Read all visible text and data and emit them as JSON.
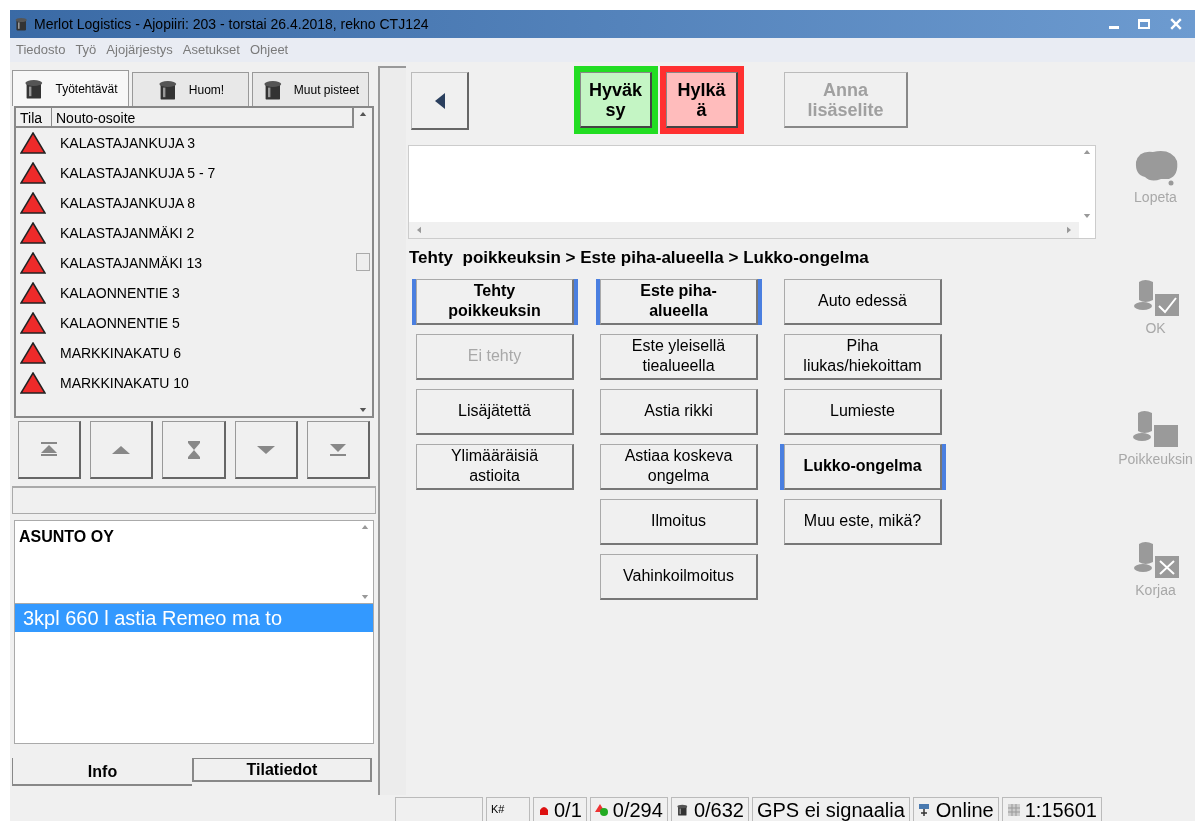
{
  "window": {
    "title": "Merlot Logistics - Ajopiiri:  203 - torstai 26.4.2018, rekno CTJ124"
  },
  "menu": [
    "Tiedosto",
    "Työ",
    "Ajojärjestys",
    "Asetukset",
    "Ohjeet"
  ],
  "top_tabs": [
    {
      "label": "Työtehtävät",
      "selected": true
    },
    {
      "label": "Huom!",
      "selected": false
    },
    {
      "label": "Muut pisteet",
      "selected": false
    }
  ],
  "table": {
    "columns": [
      "Tila",
      "Nouto-osoite"
    ],
    "rows": [
      {
        "address": "KALASTAJANKUJA 3",
        "kind": "warning"
      },
      {
        "address": "KALASTAJANKUJA 5 - 7",
        "kind": "warning"
      },
      {
        "address": "KALASTAJANKUJA 8",
        "kind": "warning"
      },
      {
        "address": "KALASTAJANMÄKI 2",
        "kind": "warning"
      },
      {
        "address": "KALASTAJANMÄKI 13",
        "kind": "warning"
      },
      {
        "address": "KALAONNENTIE 3",
        "kind": "warning"
      },
      {
        "address": "KALAONNENTIE 5",
        "kind": "warning"
      },
      {
        "address": "MARKKINAKATU 6",
        "kind": "warning"
      },
      {
        "address": "MARKKINAKATU 10",
        "kind": "warning"
      }
    ]
  },
  "info": {
    "name": "ASUNTO OY",
    "notes": [
      {
        "text": "3kpl 660 l astia Remeo ma to",
        "selected": true
      }
    ]
  },
  "bottom_tabs": [
    {
      "label": "Info",
      "selected": true
    },
    {
      "label": "Tilatiedot",
      "selected": false
    }
  ],
  "actions": [
    {
      "label": "Hyväk sy",
      "kind": "accept"
    },
    {
      "label": "Hylkä ä",
      "kind": "reject"
    },
    {
      "label": "Anna lisäselite",
      "kind": "disabled"
    }
  ],
  "breadcrumb": "Tehty  poikkeuksin > Este piha-alueella > Lukko-ongelma",
  "choices": [
    [
      {
        "label": "Tehty poikkeuksin",
        "selected": true,
        "disabled": false,
        "bold": true
      },
      {
        "label": "Ei tehty",
        "selected": false,
        "disabled": true,
        "bold": false
      },
      {
        "label": "Lisäjätettä",
        "selected": false,
        "disabled": false,
        "bold": false
      },
      {
        "label": "Ylimääräisiä astioita",
        "selected": false,
        "disabled": false,
        "bold": false
      }
    ],
    [
      {
        "label": "Este piha-alueella",
        "selected": true,
        "disabled": false,
        "bold": true
      },
      {
        "label": "Este yleisellä tiealueella",
        "selected": false,
        "disabled": false,
        "bold": false
      },
      {
        "label": "Astia rikki",
        "selected": false,
        "disabled": false,
        "bold": false
      },
      {
        "label": "Astiaa koskeva ongelma",
        "selected": false,
        "disabled": false,
        "bold": false
      },
      {
        "label": "Ilmoitus",
        "selected": false,
        "disabled": false,
        "bold": false
      },
      {
        "label": "Vahinkoilmoitus",
        "selected": false,
        "disabled": false,
        "bold": false
      }
    ],
    [
      {
        "label": "Auto edessä",
        "selected": false,
        "disabled": false,
        "bold": false
      },
      {
        "label": "Piha liukas/hiekoittam",
        "selected": false,
        "disabled": false,
        "bold": false
      },
      {
        "label": "Lumieste",
        "selected": false,
        "disabled": false,
        "bold": false
      },
      {
        "label": "Lukko-ongelma",
        "selected": true,
        "disabled": false,
        "bold": true
      },
      {
        "label": "Muu este, mikä?",
        "selected": false,
        "disabled": false,
        "bold": false
      }
    ]
  ],
  "side_actions": [
    {
      "label": "Lopeta",
      "kind": "exit"
    },
    {
      "label": "OK",
      "kind": "ok"
    },
    {
      "label": "Poikkeuksin",
      "kind": "exception"
    },
    {
      "label": "Korjaa",
      "kind": "fix"
    }
  ],
  "status_bar": [
    {
      "kind": "blank"
    },
    {
      "text": "K#",
      "kind": "small"
    },
    {
      "text": "0/1",
      "kind": "alarm"
    },
    {
      "text": "0/294",
      "kind": "points"
    },
    {
      "text": "0/632",
      "kind": "bin"
    },
    {
      "text": "GPS ei signaalia",
      "kind": "plain"
    },
    {
      "text": "Online",
      "kind": "online"
    },
    {
      "text": "1:15601",
      "kind": "scale"
    }
  ]
}
